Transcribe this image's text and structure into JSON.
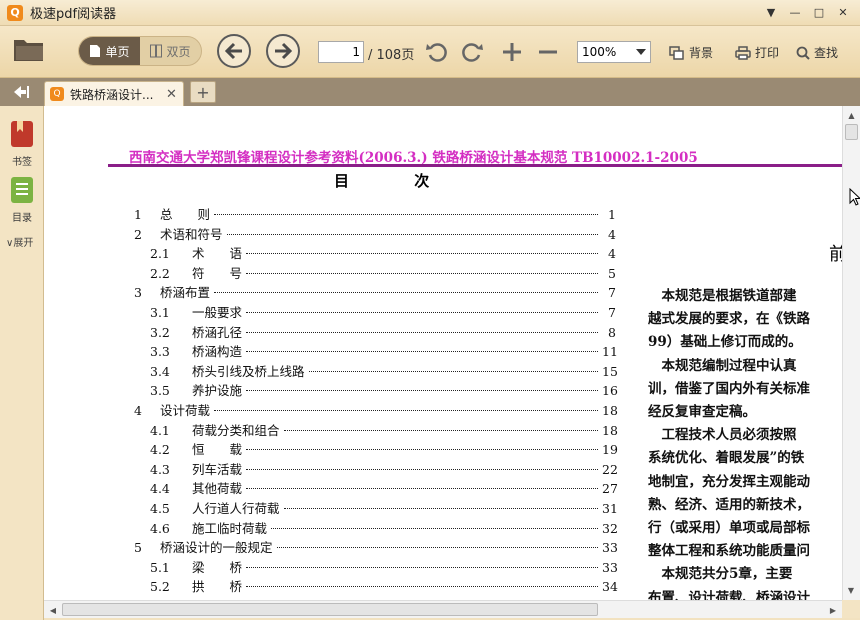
{
  "window": {
    "title": "极速pdf阅读器",
    "controls": [
      "▼",
      "—",
      "□",
      "✕"
    ]
  },
  "toolbar": {
    "single_page_label": "单页",
    "double_page_label": "双页",
    "current_page": "1",
    "total_pages": "/ 108页",
    "zoom_value": "100%",
    "background_label": "背景",
    "print_label": "打印",
    "search_label": "查找"
  },
  "tabs": {
    "active_tab_label": "铁路桥涵设计...",
    "close_glyph": "✕",
    "add_glyph": "+"
  },
  "sidebar": {
    "bookmark_label": "书签",
    "toc_label": "目录",
    "expand_label": "展开"
  },
  "document": {
    "header_text": "西南交通大学郑凯锋课程设计参考资料(2006.3.)   铁路桥涵设计基本规范  TB10002.1-2005",
    "toc_title": "目 次",
    "toc_entries": [
      {
        "num": "1",
        "title": "总　　则",
        "page": "1",
        "sub": false
      },
      {
        "num": "2",
        "title": "术语和符号",
        "page": "4",
        "sub": false
      },
      {
        "num": "2.1",
        "title": "术　　语",
        "page": "4",
        "sub": true
      },
      {
        "num": "2.2",
        "title": "符　　号",
        "page": "5",
        "sub": true
      },
      {
        "num": "3",
        "title": "桥涵布置",
        "page": "7",
        "sub": false
      },
      {
        "num": "3.1",
        "title": "一般要求",
        "page": "7",
        "sub": true
      },
      {
        "num": "3.2",
        "title": "桥涵孔径",
        "page": "8",
        "sub": true
      },
      {
        "num": "3.3",
        "title": "桥涵构造",
        "page": "11",
        "sub": true
      },
      {
        "num": "3.4",
        "title": "桥头引线及桥上线路",
        "page": "15",
        "sub": true
      },
      {
        "num": "3.5",
        "title": "养护设施",
        "page": "16",
        "sub": true
      },
      {
        "num": "4",
        "title": "设计荷载",
        "page": "18",
        "sub": false
      },
      {
        "num": "4.1",
        "title": "荷载分类和组合",
        "page": "18",
        "sub": true
      },
      {
        "num": "4.2",
        "title": "恒　　载",
        "page": "19",
        "sub": true
      },
      {
        "num": "4.3",
        "title": "列车活载",
        "page": "22",
        "sub": true
      },
      {
        "num": "4.4",
        "title": "其他荷载",
        "page": "27",
        "sub": true
      },
      {
        "num": "4.5",
        "title": "人行道人行荷载",
        "page": "31",
        "sub": true
      },
      {
        "num": "4.6",
        "title": "施工临时荷载",
        "page": "32",
        "sub": true
      },
      {
        "num": "5",
        "title": "桥涵设计的一般规定",
        "page": "33",
        "sub": false
      },
      {
        "num": "5.1",
        "title": "梁　　桥",
        "page": "33",
        "sub": true
      },
      {
        "num": "5.2",
        "title": "拱　　桥",
        "page": "34",
        "sub": true
      }
    ],
    "preface_title": "前",
    "preface_lines": [
      "　本规范是根据铁道部建",
      "越式发展的要求，在《铁路",
      "99）基础上修订而成的。",
      "　本规范编制过程中认真",
      "训，借鉴了国内外有关标准",
      "经反复审查定稿。",
      "　工程技术人员必须按照",
      "系统优化、着眼发展”的铁",
      "地制宜，充分发挥主观能动",
      "熟、经济、适用的新技术，",
      "行（或采用）单项或局部标",
      "整体工程和系统功能质量问",
      "　本规范共分5章，主要",
      "布置、设计荷载、桥涵设计"
    ]
  },
  "colors": {
    "header_text": "#d42ec2",
    "header_rule": "#8a1e88",
    "accent_orange": "#f08a1c"
  }
}
